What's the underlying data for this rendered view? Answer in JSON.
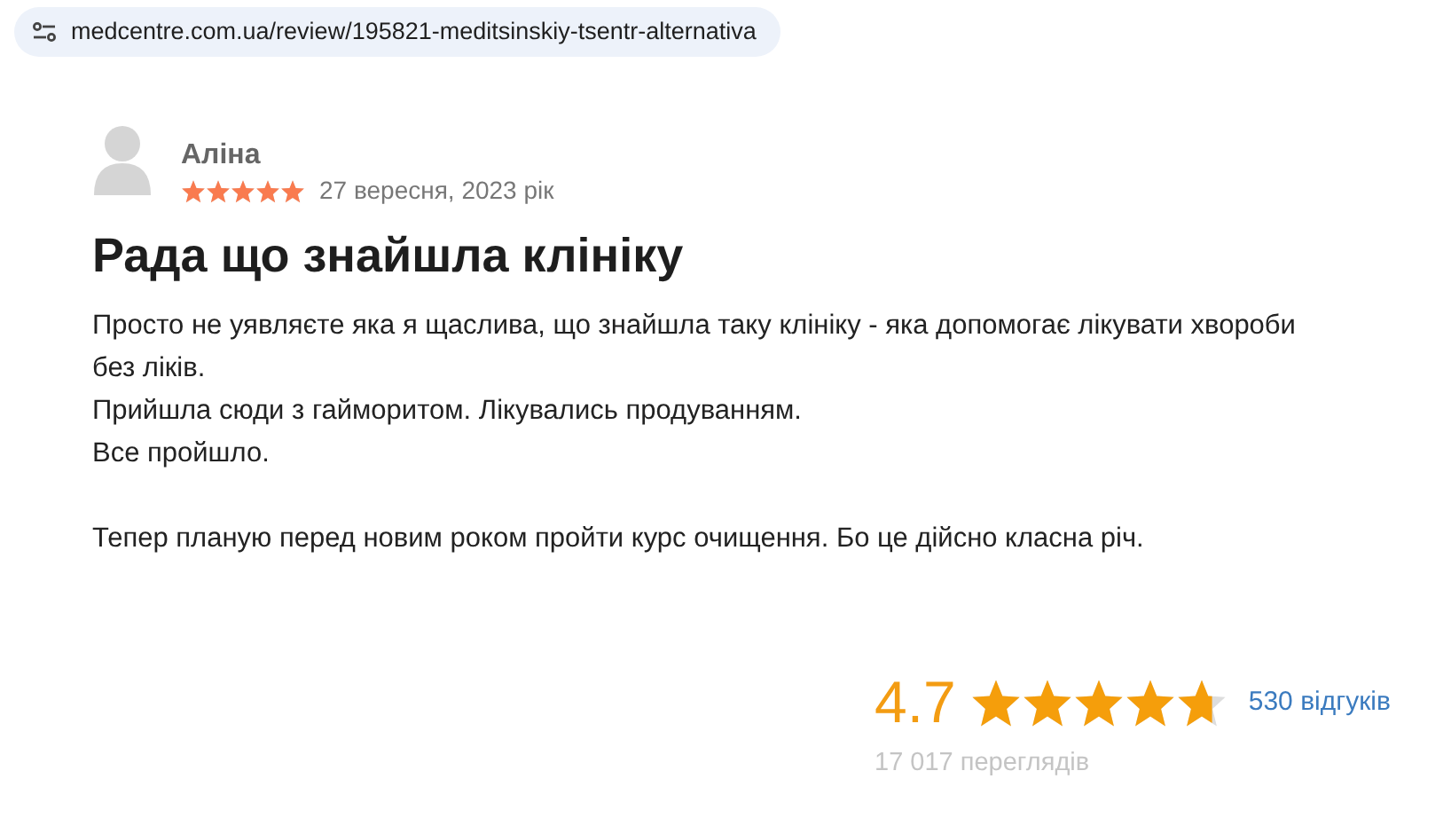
{
  "address_bar": {
    "url": "medcentre.com.ua/review/195821-meditsinskiy-tsentr-alternativa"
  },
  "review": {
    "author": "Аліна",
    "stars": 5,
    "date": "27 вересня, 2023 рік",
    "title": "Рада що знайшла клініку",
    "paragraphs": [
      [
        "Просто не уявляєте яка я щаслива, що знайшла таку клініку - яка допомогає лікувати хвороби без ліків.",
        "Прийшла сюди з гайморитом. Лікувались продуванням.",
        "Все пройшло."
      ],
      [
        "Тепер планую перед новим роком пройти курс очищення. Бо це дійсно класна річ."
      ]
    ]
  },
  "summary": {
    "rating": "4.7",
    "stars": 4.7,
    "reviews_link": "530 відгуків",
    "views": "17 017 переглядів"
  }
}
